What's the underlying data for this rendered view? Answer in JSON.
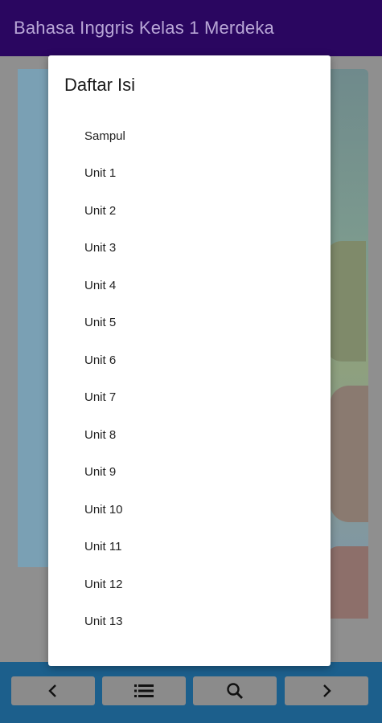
{
  "app": {
    "title": "Bahasa Inggris Kelas 1 Merdeka"
  },
  "dialog": {
    "title": "Daftar Isi",
    "items": [
      {
        "label": "Sampul"
      },
      {
        "label": "Unit 1"
      },
      {
        "label": "Unit 2"
      },
      {
        "label": "Unit 3"
      },
      {
        "label": "Unit 4"
      },
      {
        "label": "Unit 5"
      },
      {
        "label": "Unit 6"
      },
      {
        "label": "Unit 7"
      },
      {
        "label": "Unit 8"
      },
      {
        "label": "Unit 9"
      },
      {
        "label": "Unit 10"
      },
      {
        "label": "Unit 11"
      },
      {
        "label": "Unit 12"
      },
      {
        "label": "Unit 13"
      }
    ]
  },
  "bottom_nav": {
    "buttons": [
      {
        "icon": "chevron-left-icon"
      },
      {
        "icon": "list-icon"
      },
      {
        "icon": "search-icon"
      },
      {
        "icon": "chevron-right-icon"
      }
    ]
  },
  "colors": {
    "appbar": "#2a0660",
    "bottombar": "#1c5f8c",
    "dialog_bg": "#ffffff"
  }
}
